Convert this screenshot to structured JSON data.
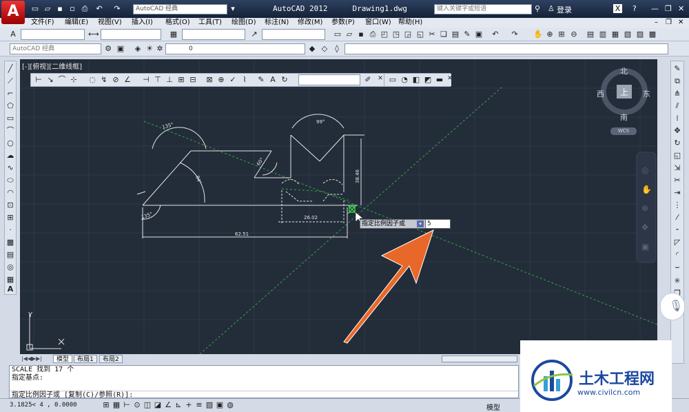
{
  "title_bar": {
    "app_title": "AutoCAD 2012",
    "document": "Drawing1.dwg",
    "workspace": "AutoCAD 经典",
    "search_placeholder": "键入关键字或短语",
    "sign_in": "登录",
    "help": "?"
  },
  "menus": [
    "文件(F)",
    "编辑(E)",
    "视图(V)",
    "插入(I)",
    "格式(O)",
    "工具(T)",
    "绘图(D)",
    "标注(N)",
    "修改(M)",
    "参数(P)",
    "窗口(W)",
    "帮助(H)"
  ],
  "toolbar": {
    "workspace_combo": "AutoCAD 经典",
    "layer_value": "0"
  },
  "viewport": {
    "label": "[-][俯视][二维线框]"
  },
  "navcube": {
    "north": "北",
    "south": "南",
    "east": "东",
    "west": "西",
    "top": "上",
    "wcs": "WCS"
  },
  "drawing": {
    "dims": [
      "135°",
      "84°",
      "60°",
      "99°",
      "135°",
      "38.46",
      "26.02",
      "62.51"
    ]
  },
  "dynamic_input": {
    "prompt": "指定比例因子或",
    "value": "5"
  },
  "layout_tabs": [
    "模型",
    "布局1",
    "布局2"
  ],
  "command_lines": [
    "SCALE 找到 17 个",
    "指定基点:",
    "",
    "指定比例因子或 [复制(C)/参照(R)]:"
  ],
  "status_bar": {
    "coords": "3.1825< 4 , 0.0000",
    "model": "模型"
  },
  "watermark": {
    "title": "土木工程网",
    "url": "www.civilcn.com"
  },
  "colors": {
    "canvas": "#232c39",
    "arrow": "#e8682a",
    "titlebar": "#1e2d46",
    "brand": "#1c48a0"
  }
}
